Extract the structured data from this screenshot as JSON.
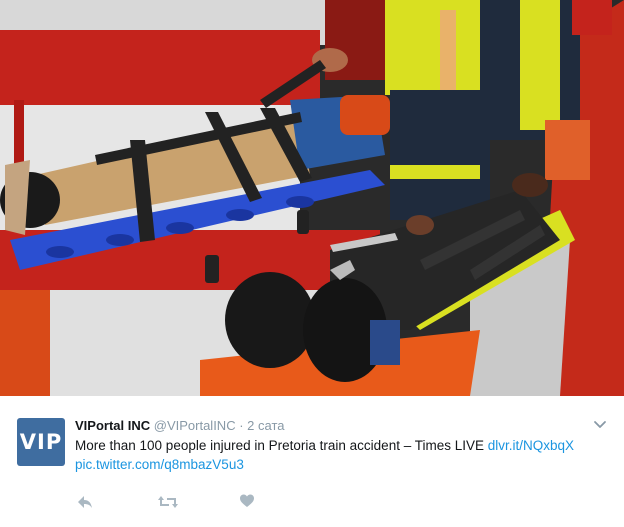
{
  "tweet": {
    "avatar_text": "VIP",
    "author_name": "VIPortal INC",
    "author_handle": "@VIPortalINC",
    "separator": "·",
    "timestamp": "2 сата",
    "text": "More than 100 people injured in Pretoria train accident – Times LIVE",
    "link_1": "dlvr.it/NQxbqX",
    "link_2": "pic.twitter.com/q8mbazV5u3"
  },
  "icons": {
    "more": "chevron-down-icon",
    "reply": "reply-icon",
    "retweet": "retweet-icon",
    "like": "heart-icon"
  },
  "colors": {
    "avatar_bg": "#3f6da0",
    "link": "#1b95e0",
    "secondary_text": "#8899a6",
    "action_icon": "#aab8c2"
  }
}
